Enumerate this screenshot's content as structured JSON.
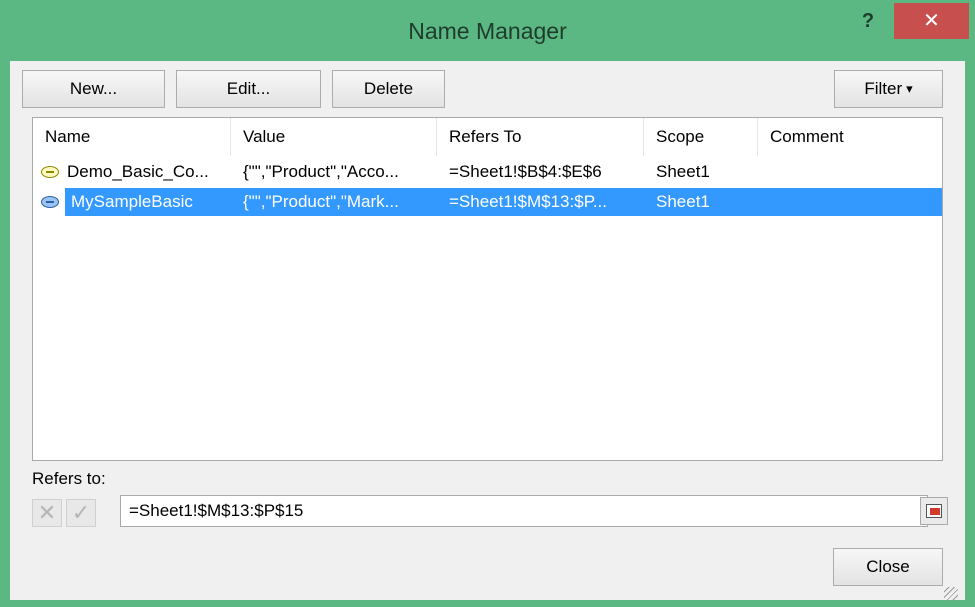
{
  "window": {
    "title": "Name Manager",
    "help_label": "?",
    "close_label": "✕"
  },
  "toolbar": {
    "new_label": "New...",
    "edit_label": "Edit...",
    "delete_label": "Delete",
    "filter_label": "Filter",
    "filter_arrow": "▾"
  },
  "table": {
    "columns": [
      "Name",
      "Value",
      "Refers To",
      "Scope",
      "Comment"
    ],
    "rows": [
      {
        "name": "Demo_Basic_Co...",
        "value": "{\"\",\"Product\",\"Acco...",
        "refers_to": "=Sheet1!$B$4:$E$6",
        "scope": "Sheet1",
        "comment": "",
        "selected": false
      },
      {
        "name": "MySampleBasic",
        "value": "{\"\",\"Product\",\"Mark...",
        "refers_to": "=Sheet1!$M$13:$P...",
        "scope": "Sheet1",
        "comment": "",
        "selected": true
      }
    ]
  },
  "refers": {
    "label": "Refers to:",
    "value": "=Sheet1!$M$13:$P$15",
    "cancel_glyph": "✕",
    "confirm_glyph": "✓"
  },
  "footer": {
    "close_label": "Close"
  },
  "colors": {
    "frame": "#5cb882",
    "close_button": "#c7504f",
    "selection": "#3399ff"
  }
}
